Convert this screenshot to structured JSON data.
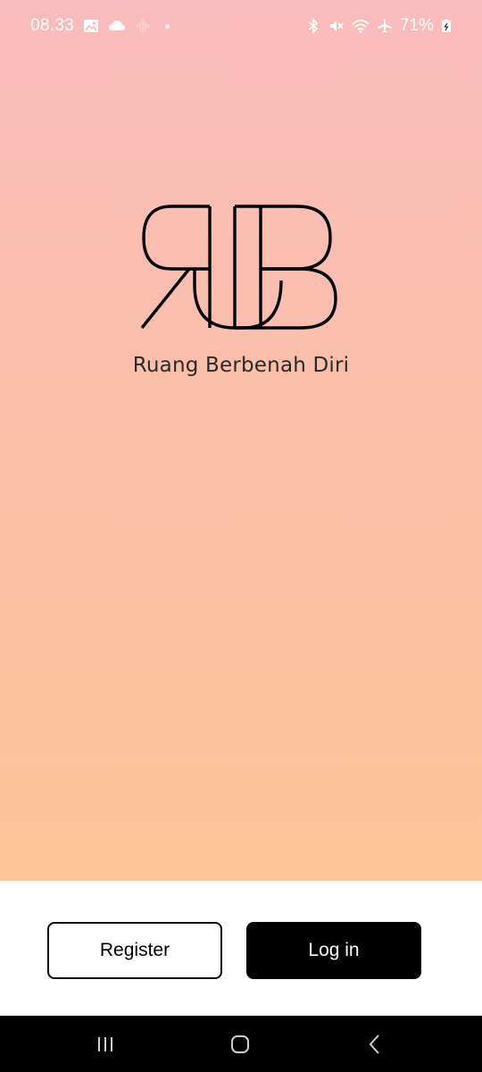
{
  "status_bar": {
    "time": "08.33",
    "battery_percent": "71%",
    "left_icons": [
      "image-icon",
      "cloud-icon",
      "sound-wave-icon",
      "notification-dot-icon"
    ],
    "right_icons": [
      "bluetooth-icon",
      "mute-icon",
      "wifi-icon",
      "airplane-icon",
      "battery-charging-icon"
    ]
  },
  "brand": {
    "logo": "RBD monogram logo",
    "name": "Ruang Berbenah Diri"
  },
  "actions": {
    "register_label": "Register",
    "login_label": "Log in"
  },
  "nav_bar": {
    "icons": [
      "recents-icon",
      "home-icon",
      "back-icon"
    ]
  },
  "colors": {
    "gradient_top": "#f9bcbc",
    "gradient_bottom": "#fcc497",
    "primary": "#000000",
    "surface": "#ffffff"
  }
}
